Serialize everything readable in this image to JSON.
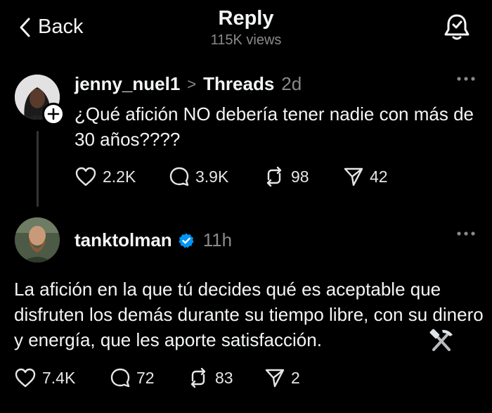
{
  "header": {
    "back_label": "Back",
    "title": "Reply",
    "views": "115K views"
  },
  "post1": {
    "username": "jenny_nuel1",
    "breadcrumb_sep": ">",
    "channel": "Threads",
    "time": "2d",
    "text": "¿Qué afición NO debería tener nadie con más de 30 años????",
    "likes": "2.2K",
    "comments": "3.9K",
    "reposts": "98",
    "shares": "42"
  },
  "post2": {
    "username": "tanktolman",
    "time": "11h",
    "text": "La afición en la que tú decides qué es aceptable que disfruten los demás durante su tiempo libre, con su dinero y energía, que les aporte satisfacción.",
    "emoji": "⚒️",
    "likes": "7.4K",
    "comments": "72",
    "reposts": "83",
    "shares": "2"
  },
  "colors": {
    "background": "#000000",
    "text": "#f3f5f7",
    "muted": "#8a8a8a",
    "verified": "#0095f6"
  }
}
